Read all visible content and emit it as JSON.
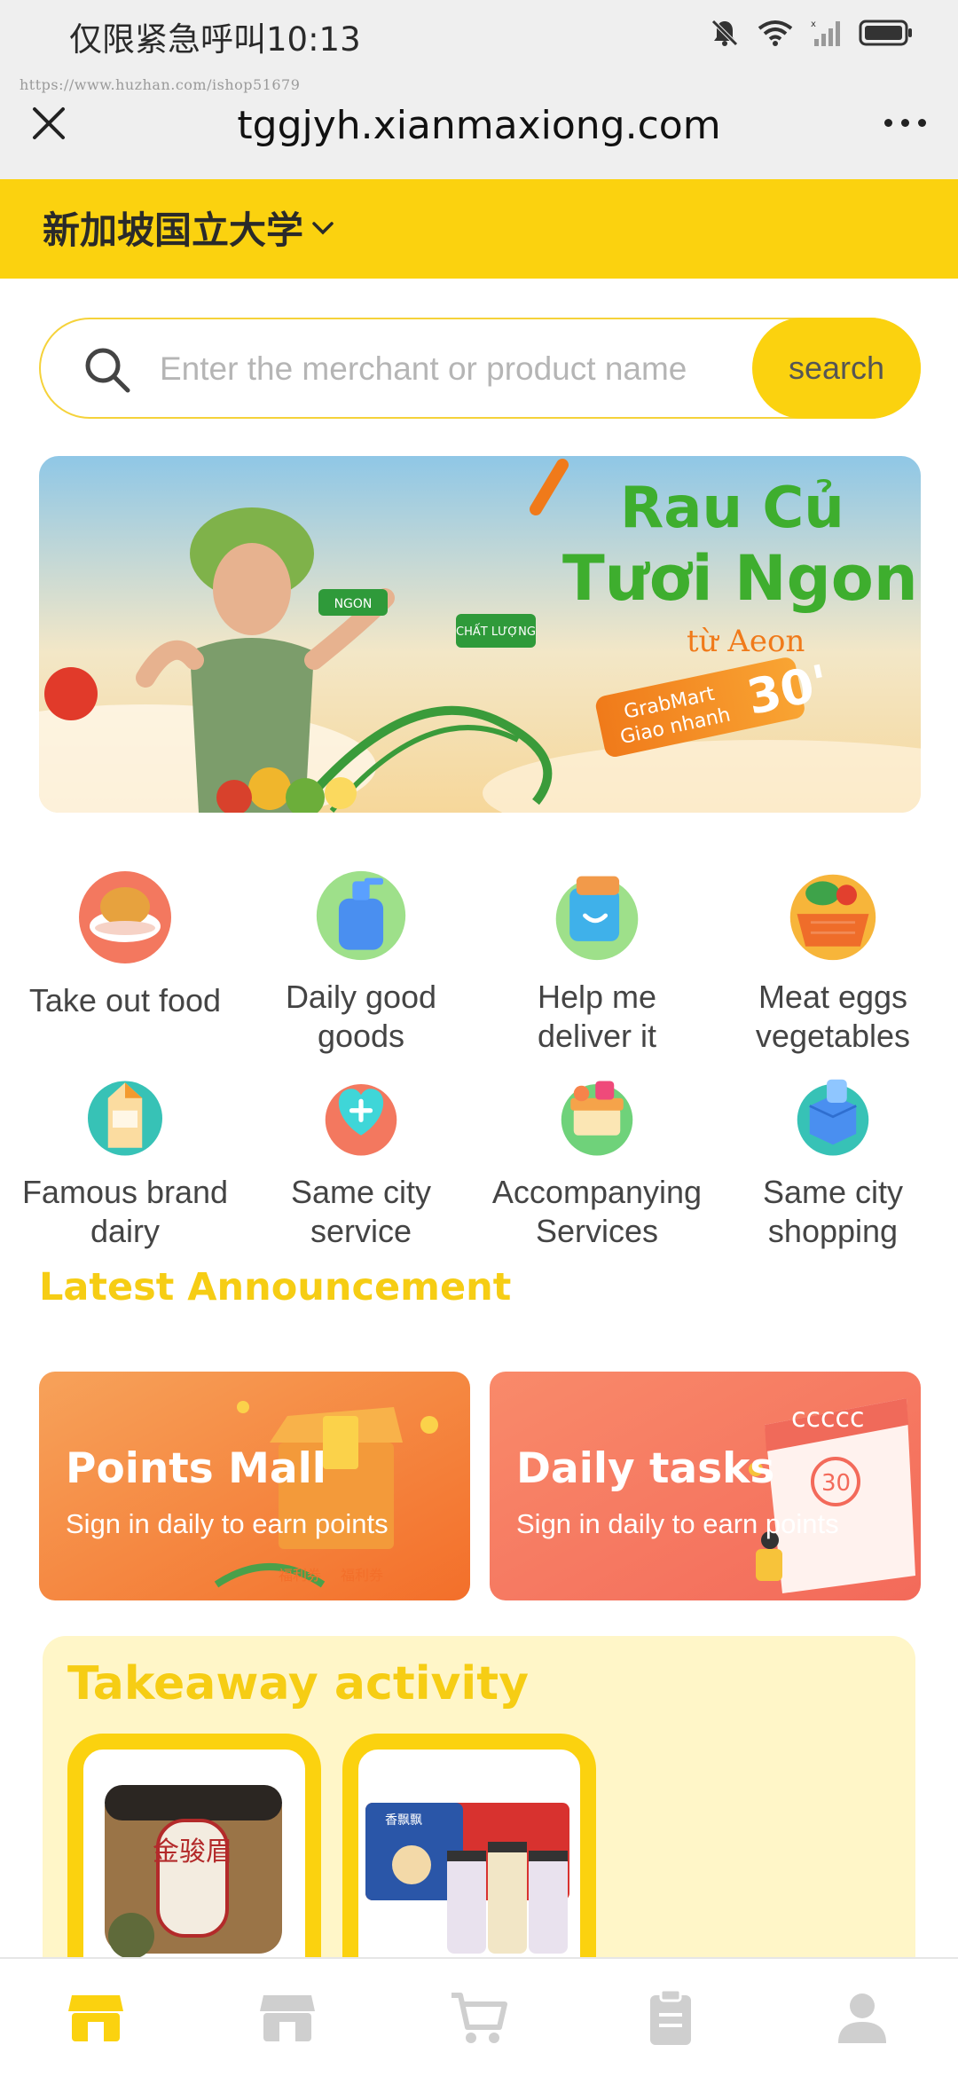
{
  "status_bar": {
    "carrier": "仅限紧急呼叫",
    "time": "10:13",
    "icons": [
      "bell-muted-icon",
      "wifi-icon",
      "signal-icon",
      "battery-icon"
    ]
  },
  "browser": {
    "watermark": "https://www.huzhan.com/ishop51679",
    "url": "tggjyh.xianmaxiong.com",
    "close_icon": "close-icon",
    "more_icon": "more-icon"
  },
  "location": {
    "name": "新加坡国立大学",
    "icon": "chevron-down-icon"
  },
  "search": {
    "placeholder": "Enter the merchant or product name",
    "value": "",
    "button_label": "search"
  },
  "banner": {
    "headline1": "Rau Củ",
    "headline2": "Tươi Ngon",
    "from": "từ Aeon",
    "tag1": "GrabMart",
    "tag2": "Giao nhanh",
    "big_num": "30'",
    "sign1": "NGON",
    "sign2": "CHẤT LƯỢNG"
  },
  "categories": [
    {
      "label": "Take out food",
      "icon": "takeout-food-icon"
    },
    {
      "label": "Daily good\ngoods",
      "icon": "daily-goods-icon"
    },
    {
      "label": "Help me\ndeliver it",
      "icon": "delivery-icon"
    },
    {
      "label": "Meat eggs\nvegetables",
      "icon": "vegetable-basket-icon"
    },
    {
      "label": "Famous brand\ndairy",
      "icon": "milk-carton-icon"
    },
    {
      "label": "Same city\nservice",
      "icon": "heart-plus-icon"
    },
    {
      "label": "Accompanying\nServices",
      "icon": "gift-box-icon"
    },
    {
      "label": "Same city\nshopping",
      "icon": "shopping-box-icon"
    }
  ],
  "announcement": {
    "title": "Latest Announcement"
  },
  "promos": {
    "points": {
      "title": "Points Mall",
      "subtitle": "Sign in daily to earn points",
      "decor1": "福利券",
      "decor2": "福利券"
    },
    "tasks": {
      "title": "Daily tasks",
      "subtitle": "Sign in daily to earn points",
      "decor_num": "30"
    }
  },
  "takeaway": {
    "title": "Takeaway activity",
    "products": [
      {
        "label": "金骏眉"
      },
      {
        "label": "香飘飘"
      }
    ]
  },
  "bottom_nav": [
    {
      "icon": "home-store-icon",
      "active": true
    },
    {
      "icon": "shop-icon",
      "active": false
    },
    {
      "icon": "cart-icon",
      "active": false
    },
    {
      "icon": "orders-clipboard-icon",
      "active": false
    },
    {
      "icon": "profile-icon",
      "active": false
    }
  ],
  "colors": {
    "accent": "#fbd20f",
    "accent_text": "#f6cd14",
    "status_bg": "#efefef",
    "takeaway_bg": "#fff6c8"
  }
}
